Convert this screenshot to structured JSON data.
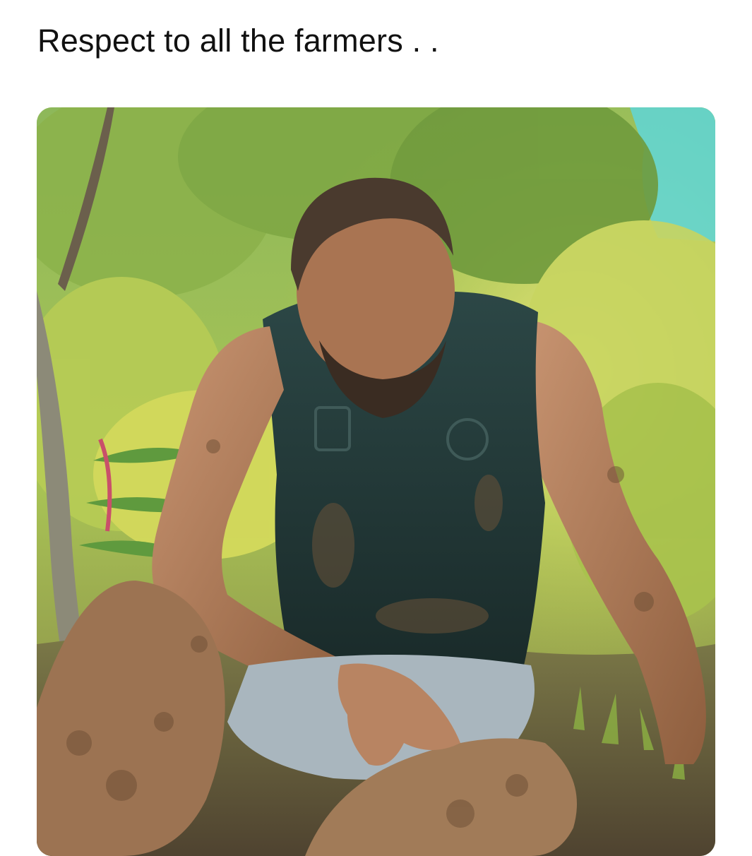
{
  "post": {
    "text": "Respect to all the farmers . ."
  },
  "media": {
    "kind": "photo",
    "subject": "photo-subject",
    "palette": {
      "sky": "#5fd6d8",
      "foliage_light": "#cfe07a",
      "foliage_mid": "#9dbe4a",
      "foliage_dark": "#4e7a2e",
      "shirt": "#243b3a",
      "skin": "#b07a55",
      "mud": "#8a6a4a",
      "shorts": "#a9b6be",
      "ground": "#6a5a3e"
    }
  }
}
